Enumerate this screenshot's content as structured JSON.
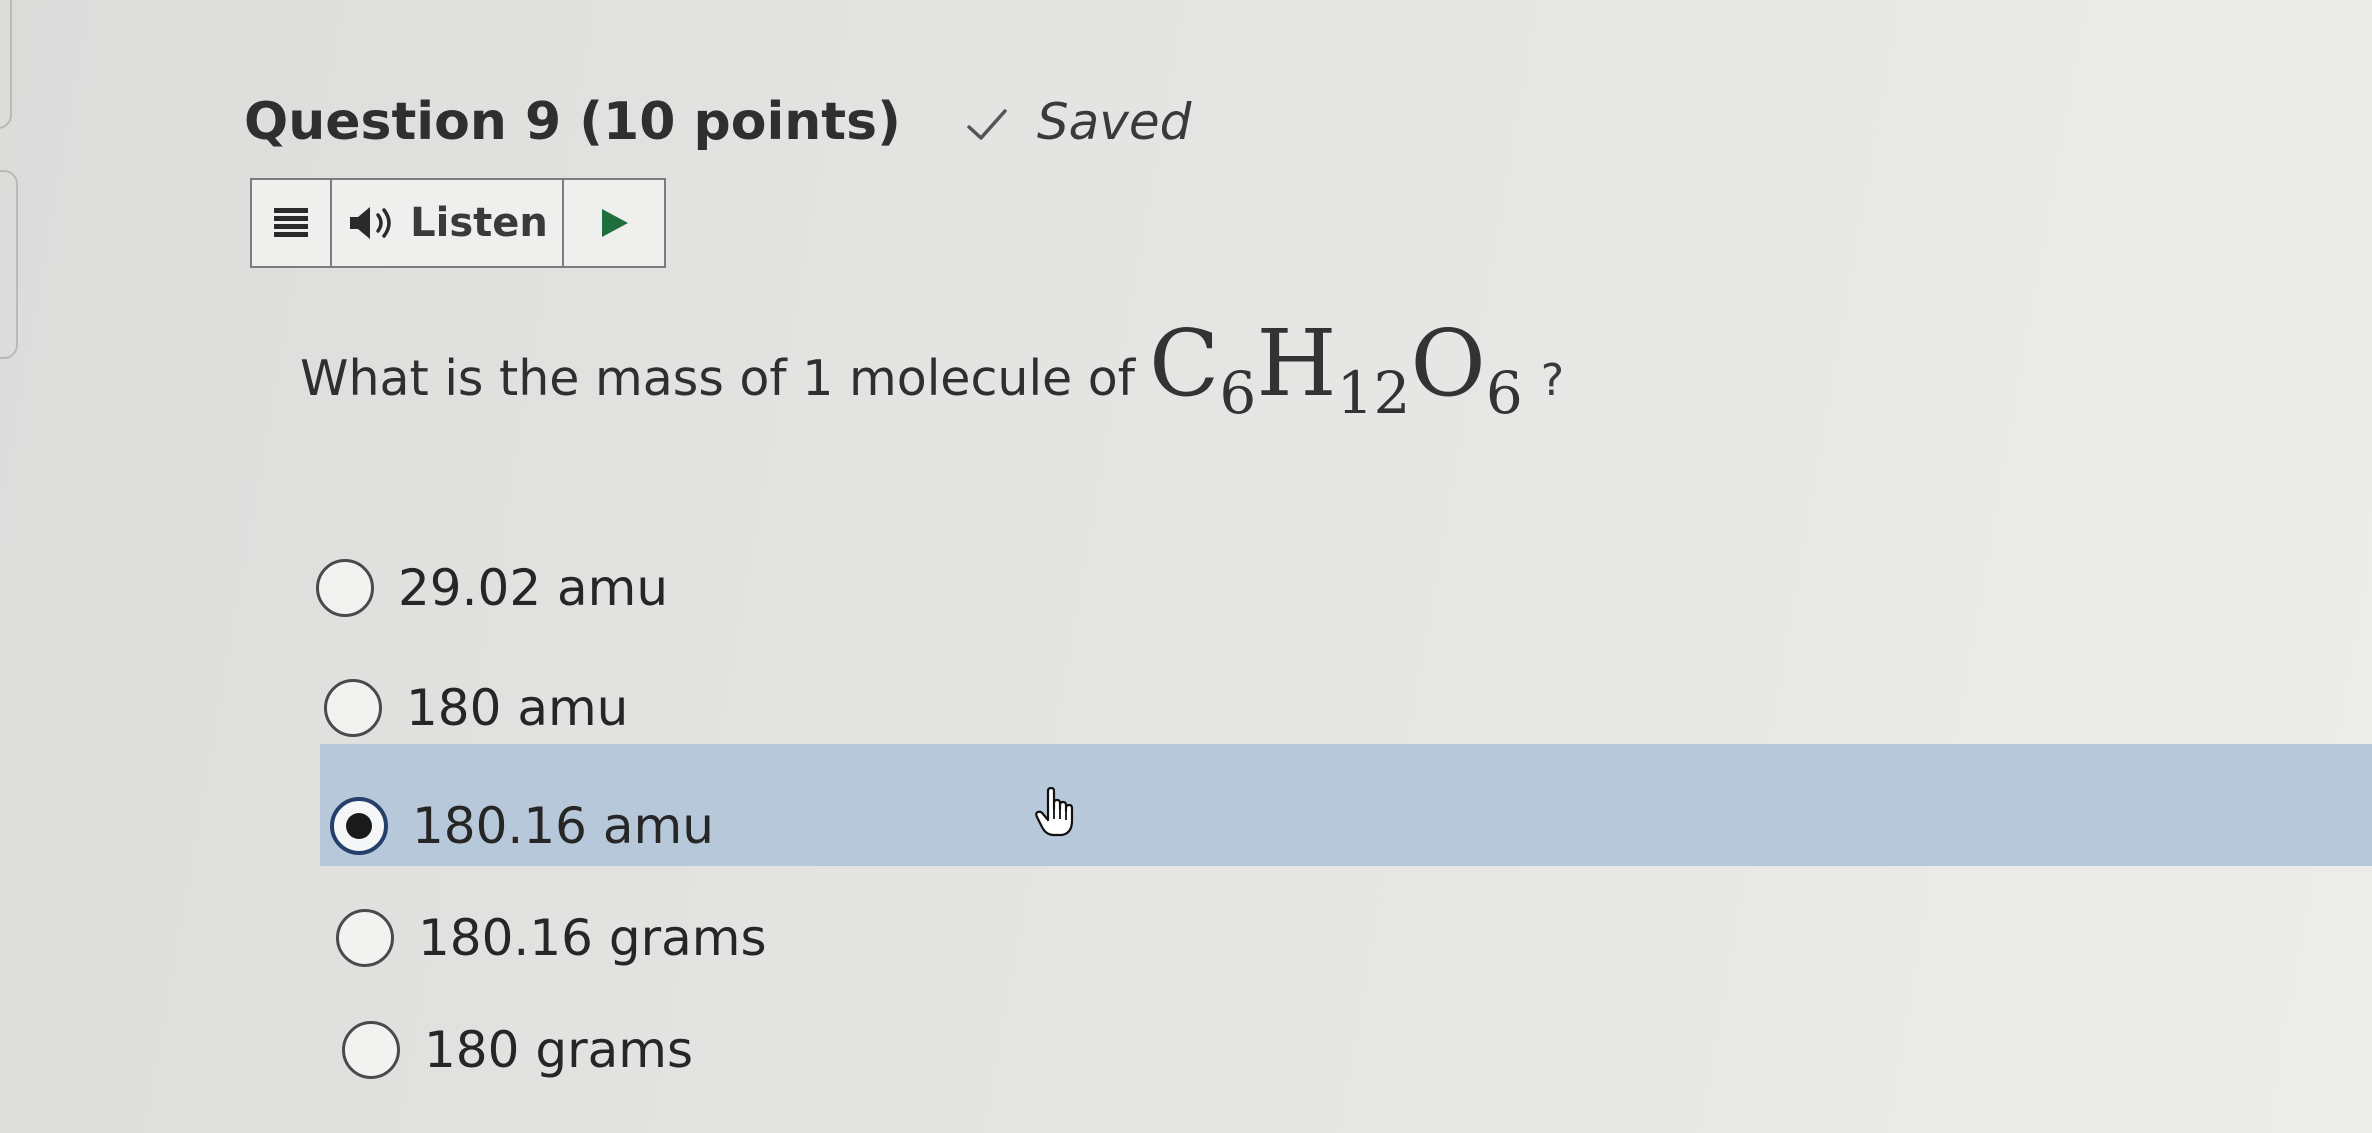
{
  "question": {
    "title": "Question 9 (10 points)",
    "status": "Saved",
    "prompt": "What is the mass of 1 molecule of",
    "formula": [
      {
        "element": "C",
        "count": "6"
      },
      {
        "element": "H",
        "count": "12"
      },
      {
        "element": "O",
        "count": "6"
      }
    ],
    "question_mark": "?"
  },
  "toolbar": {
    "menu_icon": "menu-icon",
    "speaker_icon": "speaker-icon",
    "listen_label": "Listen",
    "play_icon": "play-icon"
  },
  "options": [
    {
      "label": "29.02 amu",
      "selected": false
    },
    {
      "label": "180 amu",
      "selected": false
    },
    {
      "label": "180.16 amu",
      "selected": true
    },
    {
      "label": "180.16 grams",
      "selected": false
    },
    {
      "label": "180 grams",
      "selected": false
    }
  ],
  "colors": {
    "selected_row": "#b7c8da",
    "selected_radio_ring": "#24406a",
    "toolbar_play": "#1f6f3e"
  }
}
